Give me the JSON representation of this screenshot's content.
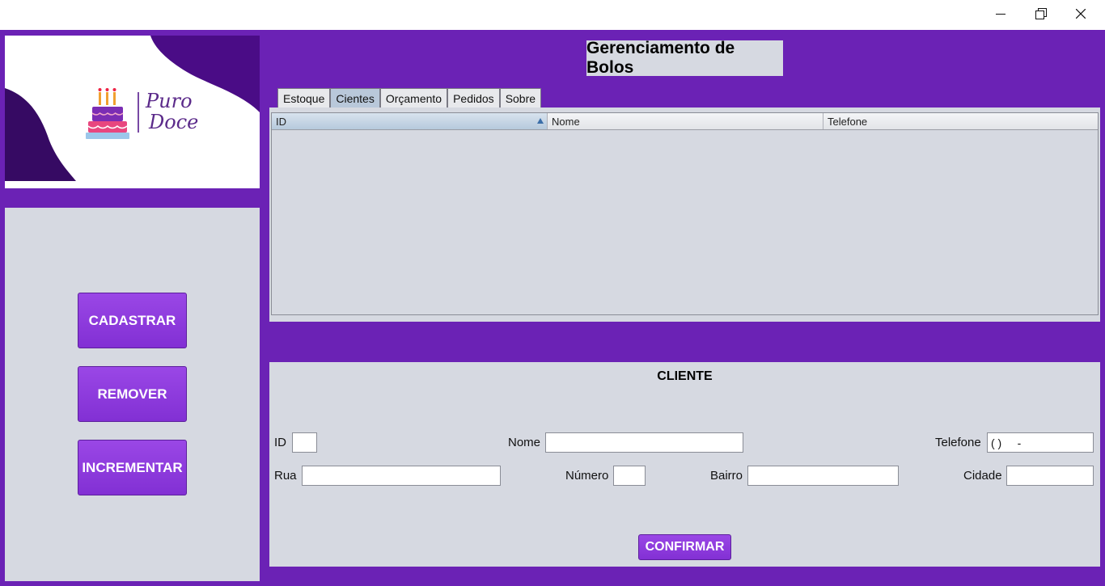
{
  "window": {
    "controls": {
      "minimize": "minimize-icon",
      "maximize": "restore-icon",
      "close": "close-icon"
    }
  },
  "logo": {
    "line1": "Puro",
    "line2": "Doce"
  },
  "sidebar": {
    "buttons": [
      {
        "label": "CADASTRAR"
      },
      {
        "label": "REMOVER"
      },
      {
        "label": "INCREMENTAR"
      }
    ]
  },
  "header": {
    "title": "Gerenciamento de Bolos"
  },
  "tabs": [
    {
      "label": "Estoque",
      "active": false
    },
    {
      "label": "Cientes",
      "active": true
    },
    {
      "label": "Orçamento",
      "active": false
    },
    {
      "label": "Pedidos",
      "active": false
    },
    {
      "label": "Sobre",
      "active": false
    }
  ],
  "table": {
    "columns": [
      "ID",
      "Nome",
      "Telefone"
    ],
    "sorted_column": "ID",
    "rows": []
  },
  "form": {
    "title": "CLIENTE",
    "fields": {
      "id": {
        "label": "ID",
        "value": ""
      },
      "nome": {
        "label": "Nome",
        "value": ""
      },
      "telefone": {
        "label": "Telefone",
        "value": "( )     -"
      },
      "rua": {
        "label": "Rua",
        "value": ""
      },
      "numero": {
        "label": "Número",
        "value": ""
      },
      "bairro": {
        "label": "Bairro",
        "value": ""
      },
      "cidade": {
        "label": "Cidade",
        "value": ""
      }
    },
    "confirm_label": "CONFIRMAR"
  },
  "colors": {
    "accent": "#6b22b5",
    "button": "#8a35dc",
    "panel": "#d6d9e1"
  }
}
